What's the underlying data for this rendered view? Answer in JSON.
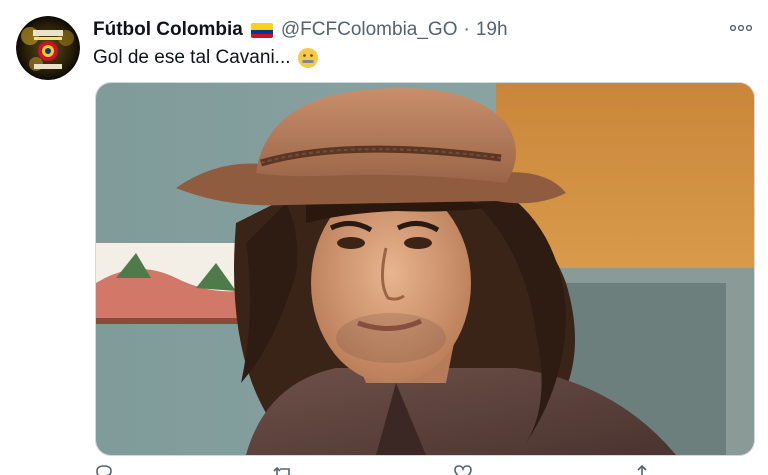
{
  "tweet": {
    "display_name": "Fútbol Colombia",
    "handle": "@FCFColombia_GO",
    "separator": "·",
    "time": "19h",
    "text": "Gol de ese tal Cavani...",
    "emoji": "zipper-mouth-face",
    "flag": "colombia-flag",
    "colors": {
      "name": "#0f1419",
      "meta": "#536471",
      "flag_yellow": "#fcd116",
      "flag_blue": "#003893",
      "flag_red": "#ce1126"
    },
    "media": {
      "kind": "photo"
    },
    "actions": [
      "reply-icon",
      "retweet-icon",
      "like-icon",
      "share-icon"
    ]
  }
}
